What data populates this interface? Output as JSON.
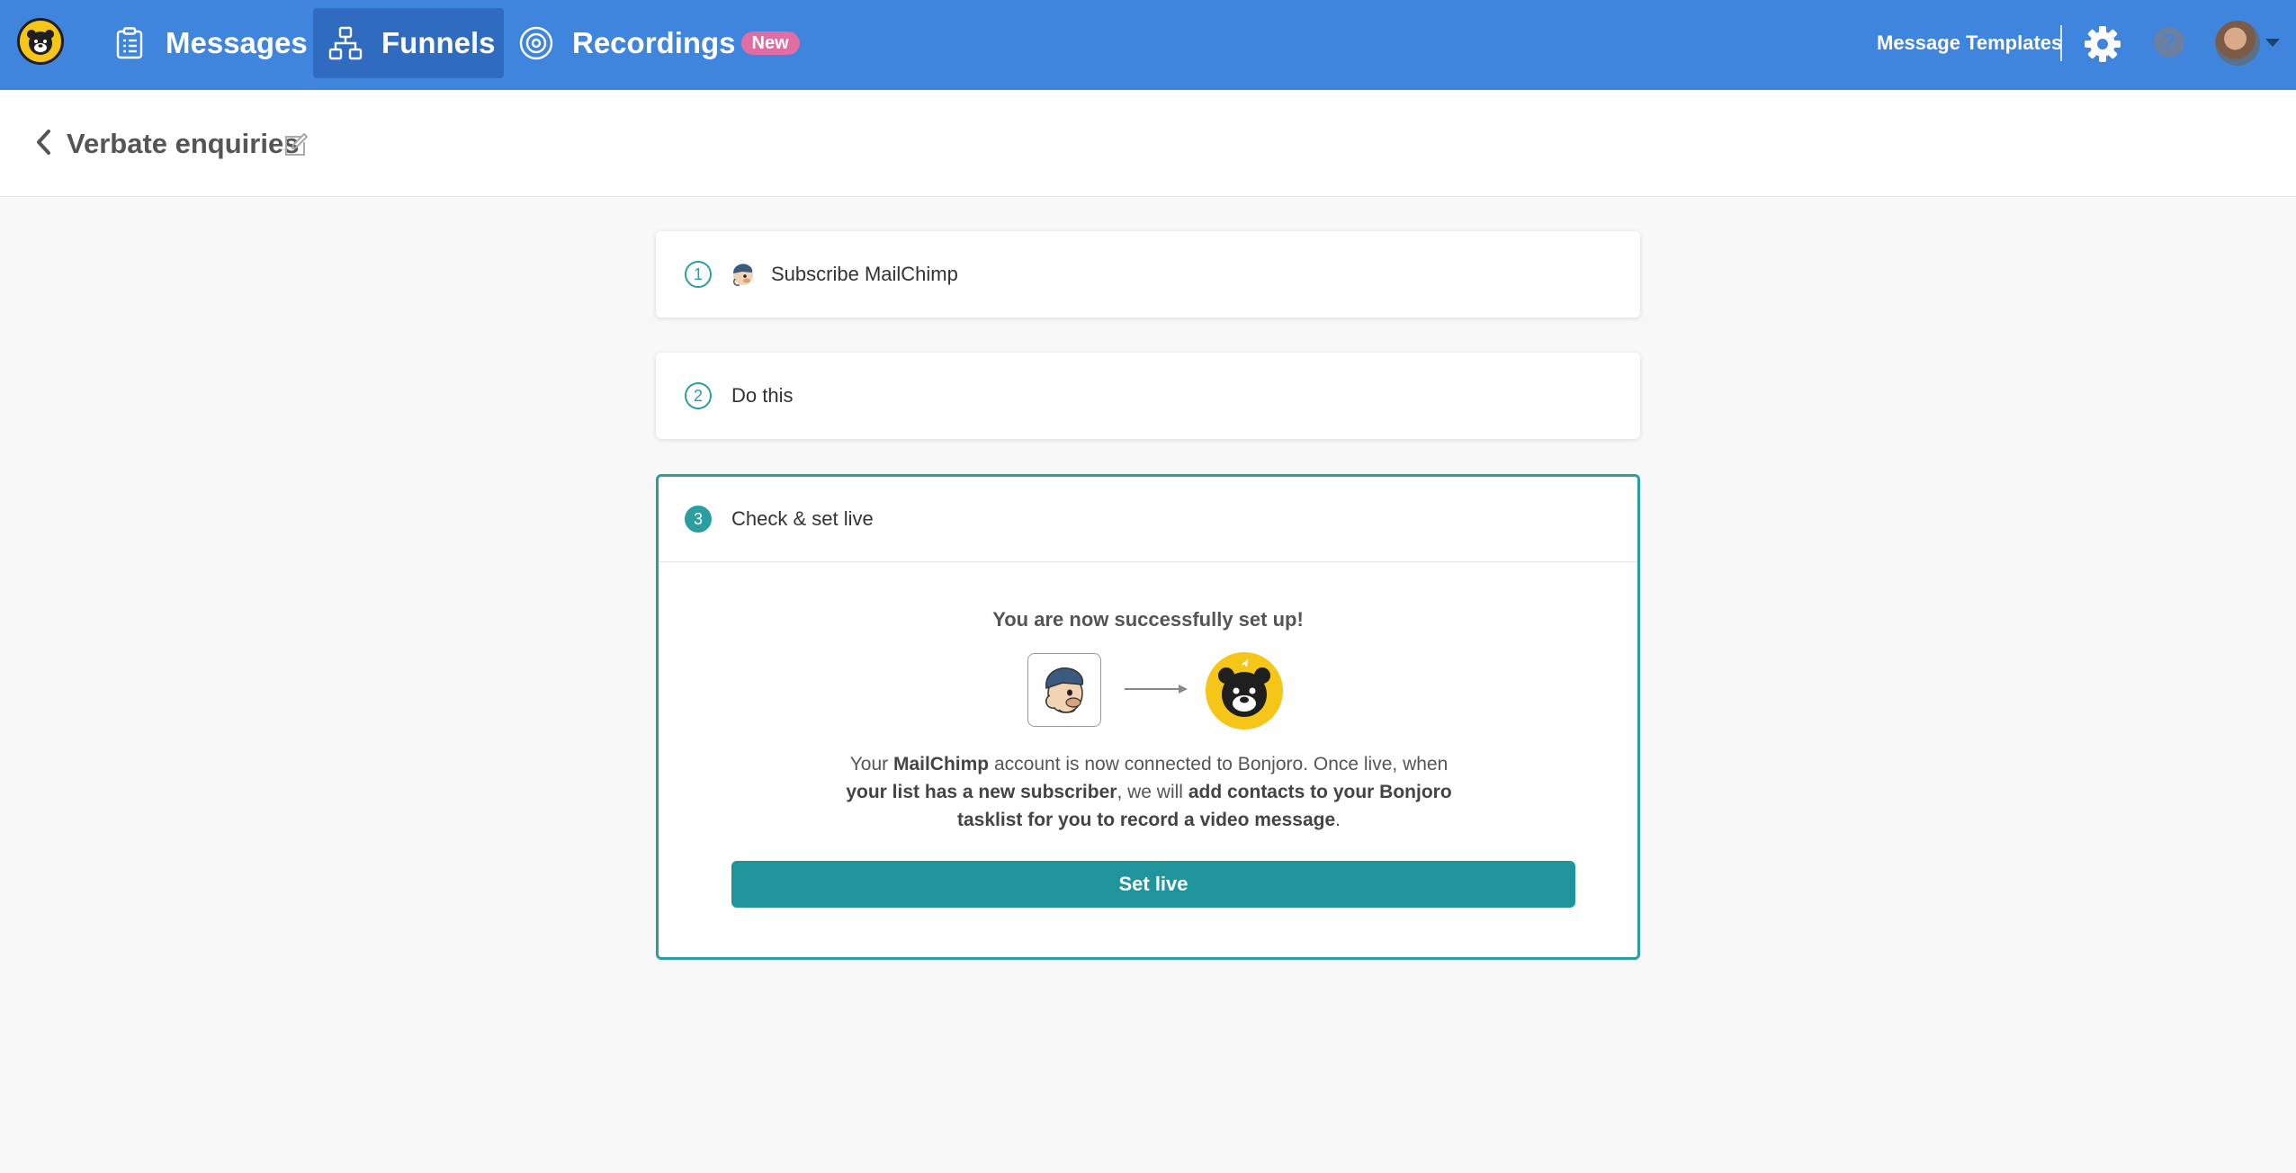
{
  "nav": {
    "messages_label": "Messages",
    "funnels_label": "Funnels",
    "recordings_label": "Recordings",
    "recordings_badge": "New",
    "message_templates_label": "Message Templates",
    "help_glyph": "?",
    "accent_color": "#3f85dd",
    "active_color": "#2f6cbf"
  },
  "header": {
    "title": "Verbate enquiries"
  },
  "steps": [
    {
      "number": "1",
      "label": "Subscribe MailChimp",
      "icon": "mailchimp-icon"
    },
    {
      "number": "2",
      "label": "Do this"
    },
    {
      "number": "3",
      "label": "Check & set live"
    }
  ],
  "setup": {
    "success_text": "You are now successfully set up!",
    "desc_part1": "Your ",
    "desc_bold1": "MailChimp",
    "desc_part2": " account is now connected to Bonjoro. Once live, when ",
    "desc_bold2": "your list has a new subscriber",
    "desc_part3": ", we will ",
    "desc_bold3": "add contacts to your Bonjoro tasklist for you to record a video message",
    "desc_part4": ".",
    "button_label": "Set live",
    "button_color": "#20949d"
  }
}
